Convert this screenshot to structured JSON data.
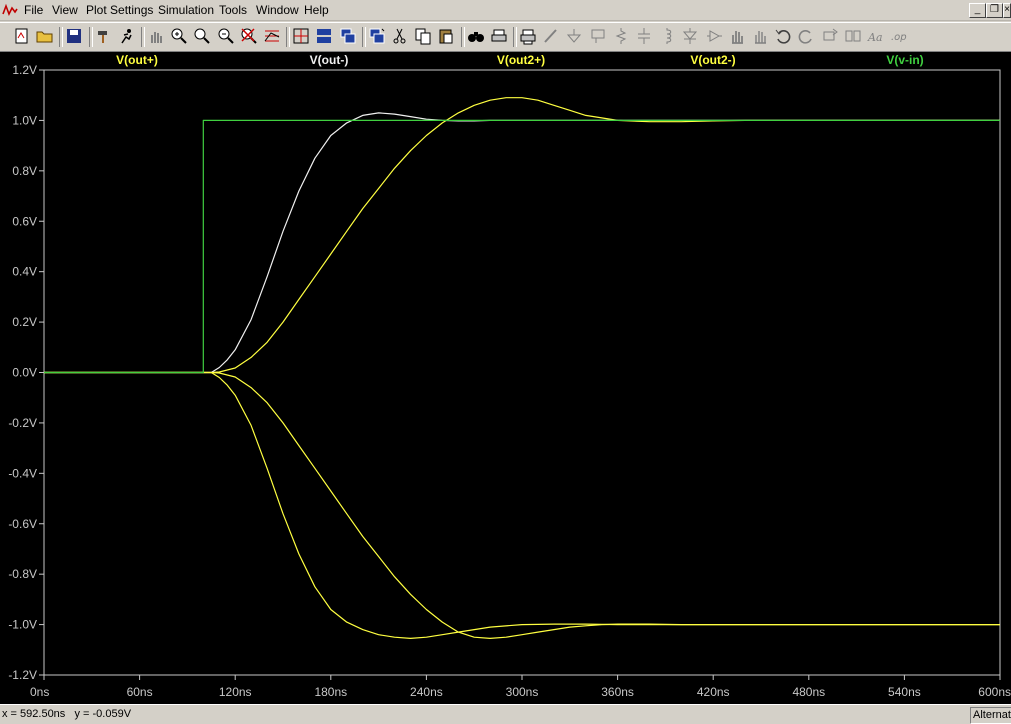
{
  "menubar": {
    "items": [
      {
        "label": "File",
        "key": "file"
      },
      {
        "label": "View",
        "key": "view"
      },
      {
        "label": "Plot Settings",
        "key": "plot-settings"
      },
      {
        "label": "Simulation",
        "key": "simulation"
      },
      {
        "label": "Tools",
        "key": "tools"
      },
      {
        "label": "Window",
        "key": "window"
      },
      {
        "label": "Help",
        "key": "help"
      }
    ]
  },
  "toolbar": {
    "buttons": [
      "new-schematic-icon",
      "open-icon",
      "save-icon",
      "hammer-icon",
      "run-icon",
      "pan-icon",
      "zoom-in-icon",
      "zoom-extents-icon",
      "zoom-out-icon",
      "cancel-zoom-icon",
      "autorange-icon",
      "measure-icon",
      "tile-horizontal-icon",
      "cascade-icon",
      "tile-vertical-icon",
      "cut-icon",
      "copy-icon",
      "paste-icon",
      "find-icon",
      "print-setup-icon",
      "print-icon",
      "wire-icon",
      "ground-icon",
      "label-icon",
      "resistor-icon",
      "capacitor-icon",
      "inductor-icon",
      "diode-icon",
      "component-icon",
      "move-icon",
      "drag-icon",
      "undo-icon",
      "redo-icon",
      "rotate-icon",
      "mirror-icon",
      "text-icon",
      "spice-directive-icon"
    ]
  },
  "statusbar": {
    "coords": "x = 592.50ns   y = -0.059V",
    "mode": "Alternate"
  },
  "colors": {
    "yellow": "#ffff40",
    "white": "#f0f0f0",
    "green": "#40d040",
    "axis": "#c8c8c8"
  },
  "chart_data": {
    "type": "line",
    "xlim": [
      0,
      600
    ],
    "ylim": [
      -1.2,
      1.2
    ],
    "xticks": [
      "0ns",
      "60ns",
      "120ns",
      "180ns",
      "240ns",
      "300ns",
      "360ns",
      "420ns",
      "480ns",
      "540ns",
      "600ns"
    ],
    "yticks": [
      "1.2V",
      "1.0V",
      "0.8V",
      "0.6V",
      "0.4V",
      "0.2V",
      "0.0V",
      "-0.2V",
      "-0.4V",
      "-0.6V",
      "-0.8V",
      "-1.0V",
      "-1.2V"
    ],
    "series": [
      {
        "name": "V(out+)",
        "color": "#ffff40",
        "x": [
          0,
          100,
          105,
          110,
          120,
          130,
          140,
          150,
          160,
          170,
          180,
          190,
          200,
          210,
          220,
          230,
          240,
          250,
          260,
          270,
          280,
          290,
          300,
          310,
          320,
          330,
          340,
          350,
          360,
          380,
          400,
          420,
          440,
          460,
          480,
          500,
          540,
          600
        ],
        "y": [
          0,
          0,
          0,
          0.002,
          0.018,
          0.06,
          0.12,
          0.2,
          0.29,
          0.38,
          0.47,
          0.56,
          0.65,
          0.73,
          0.81,
          0.88,
          0.94,
          0.99,
          1.03,
          1.06,
          1.08,
          1.09,
          1.09,
          1.08,
          1.06,
          1.04,
          1.02,
          1.01,
          1.0,
          0.995,
          0.995,
          0.998,
          1.0,
          1.0,
          1.0,
          1.0,
          1.0,
          1.0
        ]
      },
      {
        "name": "V(out-)",
        "color": "#f0f0f0",
        "x": [
          0,
          100,
          105,
          110,
          115,
          120,
          130,
          140,
          150,
          160,
          170,
          180,
          190,
          200,
          210,
          220,
          230,
          240,
          250,
          260,
          270,
          280,
          300,
          320,
          340,
          360,
          400,
          600
        ],
        "y": [
          0,
          0,
          0,
          0.02,
          0.05,
          0.09,
          0.21,
          0.38,
          0.56,
          0.72,
          0.85,
          0.94,
          0.99,
          1.02,
          1.03,
          1.025,
          1.015,
          1.005,
          1.0,
          0.998,
          0.998,
          1.0,
          1.0,
          1.0,
          1.0,
          1.0,
          1.0,
          1.0
        ]
      },
      {
        "name": "V(out2+)",
        "color": "#ffff40",
        "x": [
          0,
          100,
          105,
          110,
          115,
          120,
          130,
          140,
          150,
          160,
          170,
          180,
          190,
          200,
          210,
          220,
          230,
          240,
          250,
          260,
          270,
          280,
          300,
          320,
          340,
          360,
          400,
          600
        ],
        "y": [
          0,
          0,
          0,
          -0.02,
          -0.05,
          -0.09,
          -0.21,
          -0.38,
          -0.56,
          -0.72,
          -0.85,
          -0.94,
          -0.99,
          -1.02,
          -1.04,
          -1.05,
          -1.055,
          -1.05,
          -1.04,
          -1.03,
          -1.02,
          -1.01,
          -1.0,
          -0.998,
          -0.998,
          -1.0,
          -1.0,
          -1.0
        ]
      },
      {
        "name": "V(out2-)",
        "color": "#ffff40",
        "x": [
          0,
          100,
          105,
          110,
          120,
          130,
          140,
          150,
          160,
          170,
          180,
          190,
          200,
          210,
          220,
          230,
          240,
          250,
          260,
          270,
          280,
          290,
          300,
          310,
          320,
          330,
          340,
          350,
          360,
          380,
          400,
          420,
          440,
          460,
          480,
          500,
          540,
          600
        ],
        "y": [
          0,
          0,
          0,
          -0.002,
          -0.018,
          -0.06,
          -0.12,
          -0.2,
          -0.29,
          -0.38,
          -0.47,
          -0.56,
          -0.65,
          -0.73,
          -0.81,
          -0.88,
          -0.94,
          -0.99,
          -1.03,
          -1.05,
          -1.055,
          -1.05,
          -1.04,
          -1.03,
          -1.02,
          -1.01,
          -1.005,
          -1.0,
          -0.998,
          -0.998,
          -1.0,
          -1.0,
          -1.0,
          -1.0,
          -1.0,
          -1.0,
          -1.0,
          -1.0
        ]
      },
      {
        "name": "V(v-in)",
        "color": "#40d040",
        "x": [
          0,
          100,
          100,
          600
        ],
        "y": [
          0,
          0,
          1.0,
          1.0
        ]
      }
    ]
  }
}
